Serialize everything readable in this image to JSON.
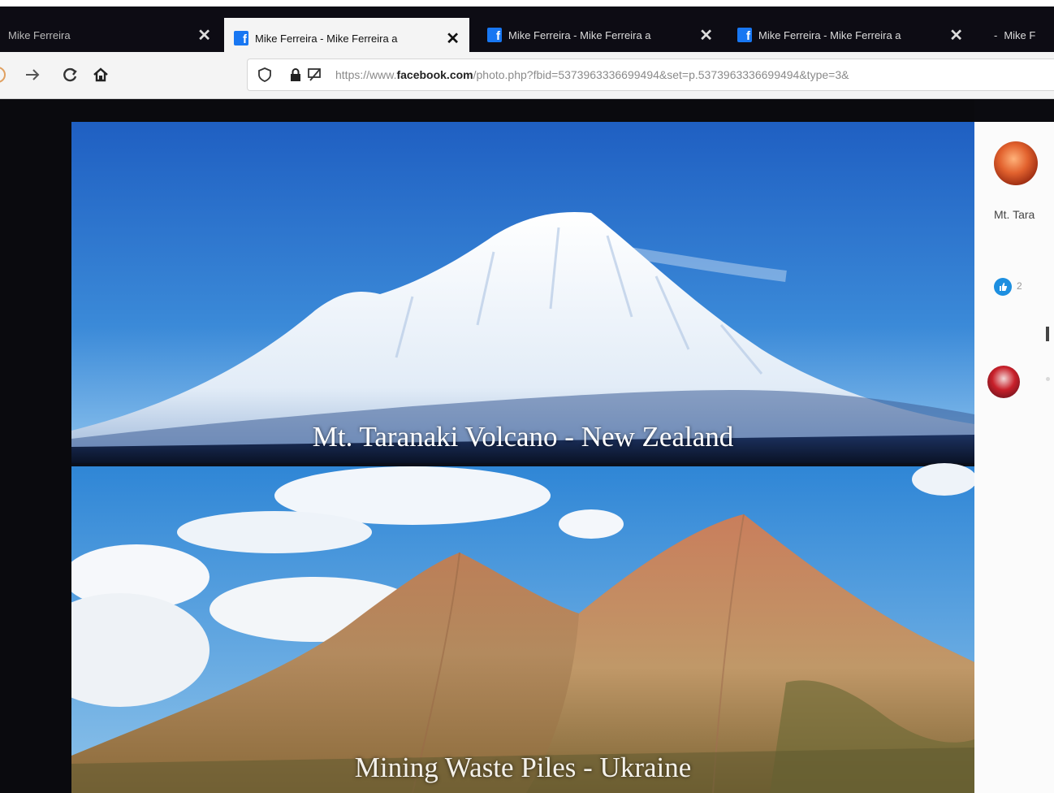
{
  "browser": {
    "tabs": [
      {
        "label": "Mike Ferreira",
        "active": false,
        "icon": "facebook-icon"
      },
      {
        "label": "Mike Ferreira - Mike Ferreira a",
        "active": true,
        "icon": "facebook-icon"
      },
      {
        "label": "Mike Ferreira - Mike Ferreira a",
        "active": false,
        "icon": "facebook-icon"
      },
      {
        "label": "Mike Ferreira - Mike Ferreira a",
        "active": false,
        "icon": "facebook-icon"
      },
      {
        "label": "Mike F",
        "active": false,
        "icon": "none"
      }
    ],
    "close_glyph": "✕",
    "url": {
      "prefix": "https://www.",
      "host": "facebook.com",
      "path": "/photo.php?fbid=5373963336699494&set=p.5373963336699494&type=3&"
    }
  },
  "photo": {
    "captions": [
      "Mt. Taranaki Volcano - New Zealand",
      "Mining Waste Piles - Ukraine"
    ]
  },
  "sidebar": {
    "post_text": "Mt. Tara",
    "reaction_count": "2",
    "reaction_icon": "like-icon"
  },
  "colors": {
    "facebook_blue": "#1877f2",
    "like_blue": "#1d8fe0"
  }
}
